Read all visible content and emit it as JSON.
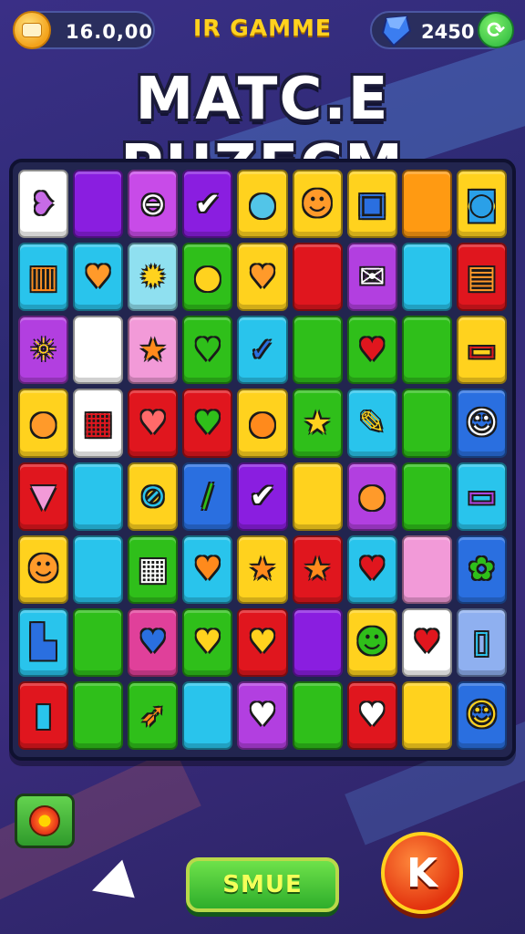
{
  "topbar": {
    "coins": "16.0,00",
    "game_label": "IR GAMME",
    "gems": "2450",
    "coin_icon": "coin-icon",
    "gem_icon": "gem-icon",
    "refresh_icon": "refresh-icon"
  },
  "title": "MATC.E PUZECM",
  "board": {
    "rows": 8,
    "cols": 9,
    "tiles": [
      {
        "color": "#ffffff",
        "icon": "eggplant-icon",
        "glyph": "❥",
        "ic": "#c76be6"
      },
      {
        "color": "#8a1ee0",
        "icon": "",
        "glyph": "",
        "ic": ""
      },
      {
        "color": "#c84be8",
        "icon": "pill-icon",
        "glyph": "⊖",
        "ic": "#ffffff"
      },
      {
        "color": "#8a1ee0",
        "icon": "heart-icon",
        "glyph": "✔",
        "ic": "#ffffff"
      },
      {
        "color": "#ffd21e",
        "icon": "fruit-icon",
        "glyph": "●",
        "ic": "#52c5e8"
      },
      {
        "color": "#ffd21e",
        "icon": "lion-icon",
        "glyph": "☻",
        "ic": "#ff9a2a"
      },
      {
        "color": "#ffd21e",
        "icon": "bag-icon",
        "glyph": "▣",
        "ic": "#2a6fe0"
      },
      {
        "color": "#ff9a12",
        "icon": "",
        "glyph": "",
        "ic": ""
      },
      {
        "color": "#ffd21e",
        "icon": "camera-icon",
        "glyph": "◙",
        "ic": "#2aa0e8"
      },
      {
        "color": "#29c4ec",
        "icon": "temple-icon",
        "glyph": "▥",
        "ic": "#ff8a1c"
      },
      {
        "color": "#29c4ec",
        "icon": "heart-icon",
        "glyph": "♥",
        "ic": "#ff9a2a"
      },
      {
        "color": "#8fe0f0",
        "icon": "star-burst-icon",
        "glyph": "✹",
        "ic": "#ffd21e"
      },
      {
        "color": "#2fbf1a",
        "icon": "pear-icon",
        "glyph": "●",
        "ic": "#ffd21e"
      },
      {
        "color": "#ffd21e",
        "icon": "heart-icon",
        "glyph": "♥",
        "ic": "#ff9a2a"
      },
      {
        "color": "#e0161e",
        "icon": "",
        "glyph": "",
        "ic": ""
      },
      {
        "color": "#b23fe0",
        "icon": "envelope-icon",
        "glyph": "✉",
        "ic": "#ffffff"
      },
      {
        "color": "#29c4ec",
        "icon": "",
        "glyph": "",
        "ic": ""
      },
      {
        "color": "#e0161e",
        "icon": "jar-icon",
        "glyph": "▤",
        "ic": "#ff9a2a"
      },
      {
        "color": "#b23fe0",
        "icon": "sun-icon",
        "glyph": "☼",
        "ic": "#ffd21e"
      },
      {
        "color": "#ffffff",
        "icon": "",
        "glyph": "",
        "ic": ""
      },
      {
        "color": "#f29ad8",
        "icon": "star-icon",
        "glyph": "★",
        "ic": "#ff8a1c"
      },
      {
        "color": "#2fbf1a",
        "icon": "apple-icon",
        "glyph": "♥",
        "ic": "#2fbf1a"
      },
      {
        "color": "#29c4ec",
        "icon": "stick-icon",
        "glyph": "✓",
        "ic": "#2a6fe0"
      },
      {
        "color": "#2fbf1a",
        "icon": "",
        "glyph": "",
        "ic": ""
      },
      {
        "color": "#2fbf1a",
        "icon": "heart-icon",
        "glyph": "♥",
        "ic": "#e0161e"
      },
      {
        "color": "#2fbf1a",
        "icon": "",
        "glyph": "",
        "ic": ""
      },
      {
        "color": "#ffd21e",
        "icon": "tablet-icon",
        "glyph": "▭",
        "ic": "#e0161e"
      },
      {
        "color": "#ffd21e",
        "icon": "mango-icon",
        "glyph": "●",
        "ic": "#ff9a2a"
      },
      {
        "color": "#ffffff",
        "icon": "calendar-icon",
        "glyph": "▦",
        "ic": "#e0161e"
      },
      {
        "color": "#e0161e",
        "icon": "heart-icon",
        "glyph": "♥",
        "ic": "#ff6a6a"
      },
      {
        "color": "#e0161e",
        "icon": "apple-icon",
        "glyph": "♥",
        "ic": "#2fbf1a"
      },
      {
        "color": "#ffd21e",
        "icon": "blob-icon",
        "glyph": "●",
        "ic": "#ff8a1c"
      },
      {
        "color": "#2fbf1a",
        "icon": "star-icon",
        "glyph": "★",
        "ic": "#ffd21e"
      },
      {
        "color": "#29c4ec",
        "icon": "pen-icon",
        "glyph": "✎",
        "ic": "#ffd21e"
      },
      {
        "color": "#2fbf1a",
        "icon": "",
        "glyph": "",
        "ic": ""
      },
      {
        "color": "#2a6fe0",
        "icon": "mascot-icon",
        "glyph": "☺",
        "ic": "#ffffff"
      },
      {
        "color": "#e0161e",
        "icon": "cup-icon",
        "glyph": "▼",
        "ic": "#f29ad8"
      },
      {
        "color": "#29c4ec",
        "icon": "",
        "glyph": "",
        "ic": ""
      },
      {
        "color": "#ffd21e",
        "icon": "bandage-icon",
        "glyph": "⊘",
        "ic": "#29c4ec"
      },
      {
        "color": "#2a6fe0",
        "icon": "stick-icon",
        "glyph": "/",
        "ic": "#2fbf1a"
      },
      {
        "color": "#8a1ee0",
        "icon": "check-icon",
        "glyph": "✔",
        "ic": "#ffffff"
      },
      {
        "color": "#ffd21e",
        "icon": "",
        "glyph": "",
        "ic": ""
      },
      {
        "color": "#b23fe0",
        "icon": "mango-icon",
        "glyph": "●",
        "ic": "#ff9a2a"
      },
      {
        "color": "#2fbf1a",
        "icon": "",
        "glyph": "",
        "ic": ""
      },
      {
        "color": "#29c4ec",
        "icon": "tablet-icon",
        "glyph": "▭",
        "ic": "#b23fe0"
      },
      {
        "color": "#ffd21e",
        "icon": "bear-icon",
        "glyph": "☻",
        "ic": "#ff9a2a"
      },
      {
        "color": "#29c4ec",
        "icon": "",
        "glyph": "",
        "ic": ""
      },
      {
        "color": "#2fbf1a",
        "icon": "calendar-icon",
        "glyph": "▦",
        "ic": "#ffffff"
      },
      {
        "color": "#29c4ec",
        "icon": "heart-icon",
        "glyph": "♥",
        "ic": "#ff8a1c"
      },
      {
        "color": "#ffd21e",
        "icon": "star-icon",
        "glyph": "★",
        "ic": "#ff8a1c"
      },
      {
        "color": "#e0161e",
        "icon": "star-icon",
        "glyph": "★",
        "ic": "#ff8a1c"
      },
      {
        "color": "#29c4ec",
        "icon": "heart-icon",
        "glyph": "♥",
        "ic": "#e0161e"
      },
      {
        "color": "#f29ad8",
        "icon": "",
        "glyph": "",
        "ic": ""
      },
      {
        "color": "#2a6fe0",
        "icon": "lollipop-icon",
        "glyph": "✿",
        "ic": "#2fbf1a"
      },
      {
        "color": "#29c4ec",
        "icon": "sock-icon",
        "glyph": "▙",
        "ic": "#2a6fe0"
      },
      {
        "color": "#2fbf1a",
        "icon": "",
        "glyph": "",
        "ic": ""
      },
      {
        "color": "#e0409a",
        "icon": "heart-icon",
        "glyph": "♥",
        "ic": "#2a6fe0"
      },
      {
        "color": "#2fbf1a",
        "icon": "heart-icon",
        "glyph": "♥",
        "ic": "#ffd21e"
      },
      {
        "color": "#e0161e",
        "icon": "heart-icon",
        "glyph": "♥",
        "ic": "#ffd21e"
      },
      {
        "color": "#8a1ee0",
        "icon": "",
        "glyph": "",
        "ic": ""
      },
      {
        "color": "#ffd21e",
        "icon": "lion-icon",
        "glyph": "☻",
        "ic": "#2fbf1a"
      },
      {
        "color": "#ffffff",
        "icon": "heart-icon",
        "glyph": "♥",
        "ic": "#e0161e"
      },
      {
        "color": "#8fb0f0",
        "icon": "phone-icon",
        "glyph": "▯",
        "ic": "#29c4ec"
      },
      {
        "color": "#e0161e",
        "icon": "bottle-icon",
        "glyph": "▮",
        "ic": "#29c4ec"
      },
      {
        "color": "#2fbf1a",
        "icon": "",
        "glyph": "",
        "ic": ""
      },
      {
        "color": "#2fbf1a",
        "icon": "rocket-icon",
        "glyph": "➶",
        "ic": "#ff8a1c"
      },
      {
        "color": "#29c4ec",
        "icon": "",
        "glyph": "",
        "ic": ""
      },
      {
        "color": "#b23fe0",
        "icon": "heart-icon",
        "glyph": "♥",
        "ic": "#ffffff"
      },
      {
        "color": "#2fbf1a",
        "icon": "",
        "glyph": "",
        "ic": ""
      },
      {
        "color": "#e0161e",
        "icon": "heart-icon",
        "glyph": "♥",
        "ic": "#ffffff"
      },
      {
        "color": "#ffd21e",
        "icon": "",
        "glyph": "",
        "ic": ""
      },
      {
        "color": "#2a6fe0",
        "icon": "lollipop-icon",
        "glyph": "☺",
        "ic": "#ffd21e"
      }
    ]
  },
  "bottom": {
    "powerup_icon": "flower-powerup-icon",
    "back_icon": "back-arrow-icon",
    "main_button": "SMUE",
    "close_button": "K",
    "close_icon": "close-icon"
  }
}
